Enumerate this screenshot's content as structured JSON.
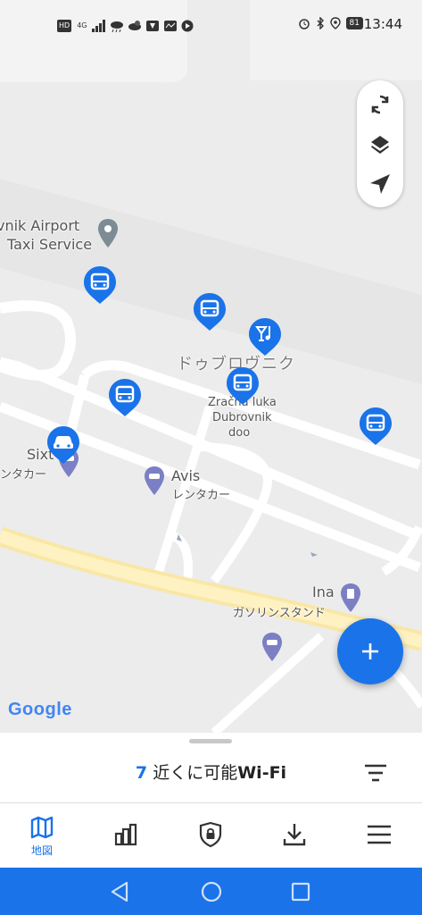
{
  "status_bar": {
    "time": "13:44",
    "battery": "81",
    "left_icons": [
      "hd-icon",
      "4g-signal-icon",
      "signal-bars-icon",
      "weather-icon",
      "weather-icon",
      "app-icon",
      "app-icon",
      "play-icon"
    ],
    "left_icon_texts": [
      "HD",
      "4G",
      "",
      "",
      "",
      "",
      "",
      ""
    ],
    "right_icons": [
      "alarm-icon",
      "bluetooth-icon",
      "location-icon",
      "battery-icon"
    ]
  },
  "map": {
    "labels": {
      "airport_taxi_line1": "vnik Airport",
      "airport_taxi_line2": "Taxi Service",
      "city": "ドゥブロヴニク",
      "port_line1": "Zračna luka",
      "port_line2": "Dubrovnik",
      "port_line3": "doo",
      "sixt": "Sixt",
      "sixt_sub": "ンタカー",
      "avis": "Avis",
      "avis_sub": "レンタカー",
      "ina": "Ina",
      "ina_sub": "ガソリンスタンド"
    },
    "attribution": "Google",
    "colors": {
      "land": "#ececec",
      "road": "#ffffff",
      "highway": "#f9e7a6",
      "marker": "#1a73e8",
      "poi_purple": "#7b7fc4",
      "poi_gray": "#7d8b95"
    }
  },
  "map_controls": {
    "refresh_icon": "refresh-icon",
    "layers_icon": "layers-icon",
    "locate_icon": "navigation-arrow-icon"
  },
  "fab": {
    "icon": "plus-icon"
  },
  "sheet": {
    "count": "7",
    "title": "近くに可能",
    "wifi": "Wi-Fi"
  },
  "tabs": [
    {
      "name": "map",
      "label": "地図",
      "icon": "map-icon",
      "active": true
    },
    {
      "name": "stats",
      "label": "",
      "icon": "bar-chart-icon",
      "active": false
    },
    {
      "name": "vpn",
      "label": "",
      "icon": "shield-lock-icon",
      "active": false
    },
    {
      "name": "download",
      "label": "",
      "icon": "download-icon",
      "active": false
    },
    {
      "name": "menu",
      "label": "",
      "icon": "hamburger-menu-icon",
      "active": false
    }
  ],
  "nav_bar": {
    "back_icon": "back-triangle-icon",
    "home_icon": "home-circle-icon",
    "recents_icon": "recents-square-icon"
  }
}
